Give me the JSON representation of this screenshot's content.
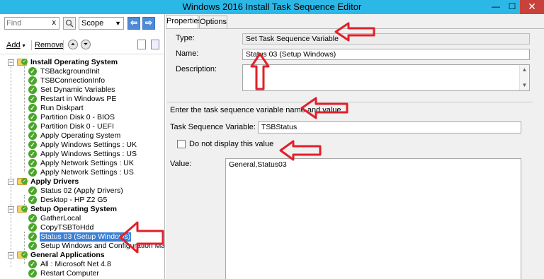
{
  "window": {
    "title": "Windows 2016 Install Task Sequence Editor",
    "min_label": "—",
    "max_label": "☐",
    "close_label": "✕"
  },
  "left_toolbar": {
    "find_placeholder": "Find",
    "find_clear": "x",
    "scope_value": "Scope",
    "add_label": "Add",
    "remove_label": "Remove"
  },
  "tree": {
    "groups": [
      {
        "label": "Install Operating System",
        "items": [
          "TSBackgroundInit",
          "TSBConnectionInfo",
          "Set Dynamic Variables",
          "Restart in Windows PE",
          "Run Diskpart",
          "Partition Disk 0 - BIOS",
          "Partition Disk 0 - UEFI",
          "Apply Operating System",
          "Apply Windows Settings : UK",
          "Apply Windows Settings : US",
          "Apply Network Settings : UK",
          "Apply Network Settings : US"
        ]
      },
      {
        "label": "Apply Drivers",
        "items": [
          "Status 02 (Apply Drivers)",
          "Desktop - HP Z2 G5"
        ]
      },
      {
        "label": "Setup Operating System",
        "items": [
          "GatherLocal",
          "CopyTSBToHdd",
          "Status 03 (Setup Windows)",
          "Setup Windows and Configuration Manager"
        ]
      },
      {
        "label": "General Applications",
        "items": [
          "All : Microsoft Net 4.8",
          "Restart Computer"
        ]
      }
    ],
    "selected_item": "Status 03 (Setup Windows)"
  },
  "tabs": [
    "Properties",
    "Options"
  ],
  "properties": {
    "type_label": "Type:",
    "type_value": "Set Task Sequence Variable",
    "name_label": "Name:",
    "name_value": "Status 03 (Setup Windows)",
    "description_label": "Description:",
    "description_value": "",
    "instruction": "Enter the task sequence variable name and value.",
    "variable_label": "Task Sequence Variable:",
    "variable_value": "TSBStatus",
    "hide_value_label": "Do not display this value",
    "value_label": "Value:",
    "value_value": "General,Status03"
  },
  "colors": {
    "titlebar": "#2cb8e6",
    "close_button": "#c7423a",
    "selection": "#3a7fd5",
    "annotation_arrow": "#e0202a",
    "success_check": "#49a62a"
  }
}
